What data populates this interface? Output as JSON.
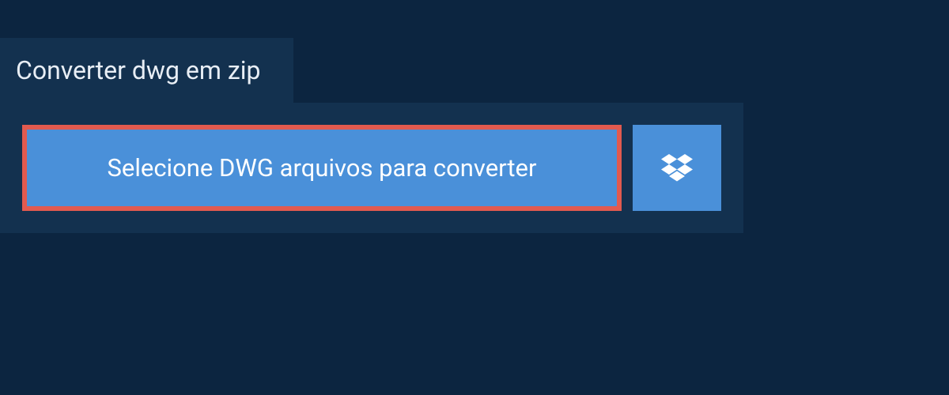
{
  "tab": {
    "title": "Converter dwg em zip"
  },
  "upload": {
    "select_label": "Selecione DWG arquivos para converter"
  }
}
